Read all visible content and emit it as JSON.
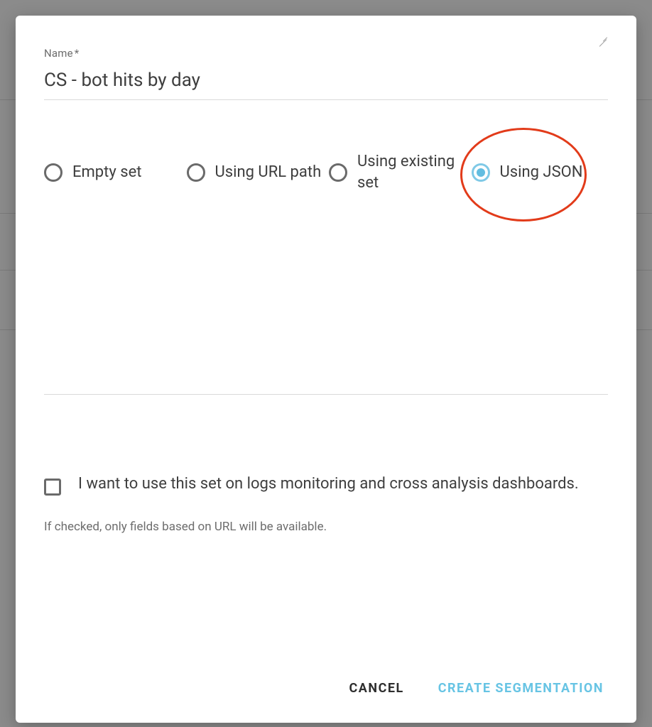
{
  "form": {
    "name_label": "Name",
    "name_required_mark": "*",
    "name_value": "CS - bot hits by day",
    "options": [
      {
        "id": "empty-set",
        "label": "Empty set",
        "selected": false
      },
      {
        "id": "using-url-path",
        "label": "Using URL path",
        "selected": false
      },
      {
        "id": "using-existing",
        "label": "Using existing set",
        "selected": false
      },
      {
        "id": "using-json",
        "label": "Using JSON",
        "selected": true
      }
    ],
    "json_textarea_value": "",
    "checkbox": {
      "checked": false,
      "label": "I want to use this set on logs monitoring and cross analysis dashboards."
    },
    "helper_text": "If checked, only fields based on URL will be available."
  },
  "actions": {
    "cancel": "Cancel",
    "submit": "Create Segmentation"
  },
  "annotation": {
    "highlighted_option": "using-json"
  },
  "colors": {
    "accent": "#67c4e4",
    "annotation_stroke": "#e23b1a",
    "text_primary": "#3e3e3e",
    "text_muted": "#6d6d6d",
    "divider": "#d9d9d9"
  }
}
